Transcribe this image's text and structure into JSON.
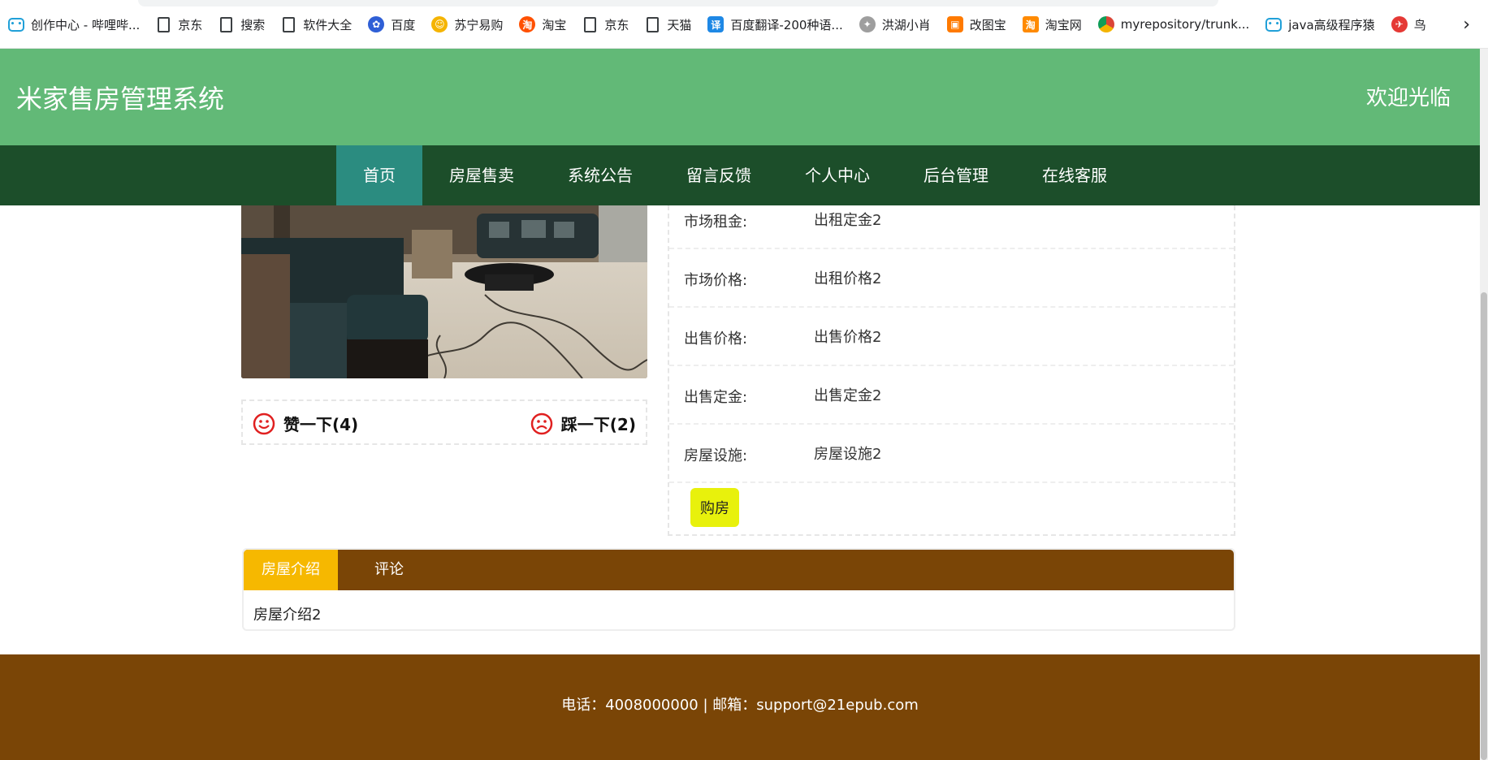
{
  "bookmarks": [
    {
      "label": "创作中心 - 哔哩哔...",
      "icon": "bilibili-icon"
    },
    {
      "label": "京东",
      "icon": "page-icon"
    },
    {
      "label": "搜索",
      "icon": "page-icon"
    },
    {
      "label": "软件大全",
      "icon": "page-icon"
    },
    {
      "label": "百度",
      "icon": "baidu-paw-icon"
    },
    {
      "label": "苏宁易购",
      "icon": "suning-icon"
    },
    {
      "label": "淘宝",
      "icon": "taobao-icon"
    },
    {
      "label": "京东",
      "icon": "page-icon"
    },
    {
      "label": "天猫",
      "icon": "page-icon"
    },
    {
      "label": "百度翻译-200种语...",
      "icon": "translate-icon"
    },
    {
      "label": "洪湖小肖",
      "icon": "bird-icon"
    },
    {
      "label": "改图宝",
      "icon": "gaitubao-icon"
    },
    {
      "label": "淘宝网",
      "icon": "taobao-icon"
    },
    {
      "label": "myrepository/trunk...",
      "icon": "chrome-icon"
    },
    {
      "label": "java高级程序猿",
      "icon": "bilibili-icon"
    },
    {
      "label": "鸟",
      "icon": "red-bird-icon"
    }
  ],
  "header": {
    "title": "米家售房管理系统",
    "welcome": "欢迎光临"
  },
  "nav": {
    "items": [
      "首页",
      "房屋售卖",
      "系统公告",
      "留言反馈",
      "个人中心",
      "后台管理",
      "在线客服"
    ],
    "active_index": 0
  },
  "votes": {
    "like_label": "赞一下(4)",
    "dislike_label": "踩一下(2)"
  },
  "info": {
    "rows": [
      {
        "label": "市场租金:",
        "value": "出租定金2"
      },
      {
        "label": "市场价格:",
        "value": "出租价格2"
      },
      {
        "label": "出售价格:",
        "value": "出售价格2"
      },
      {
        "label": "出售定金:",
        "value": "出售定金2"
      },
      {
        "label": "房屋设施:",
        "value": "房屋设施2"
      }
    ],
    "buy_label": "购房"
  },
  "tabs": {
    "items": [
      "房屋介绍",
      "评论"
    ],
    "content": "房屋介绍2"
  },
  "footer": {
    "text": "电话：4008000000 | 邮箱：support@21epub.com"
  },
  "colors": {
    "header_bg": "#62b977",
    "nav_bg": "#1c4e2a",
    "nav_active": "#2b8c80",
    "footer_bg": "#7a4506",
    "tab_active": "#f6b800",
    "buy_button": "#e8f10c"
  }
}
